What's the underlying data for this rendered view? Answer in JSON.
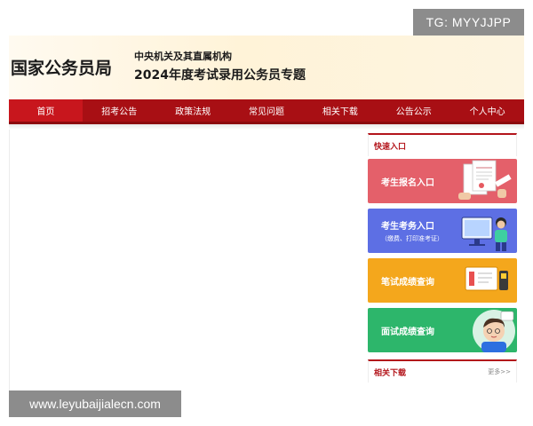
{
  "watermarks": {
    "tg": "TG: MYYJJPP",
    "url": "www.leyubaijialecn.com"
  },
  "banner": {
    "title": "国家公务员局",
    "subtitle_line1": "中央机关及其直属机构",
    "subtitle_line2": "2024年度考试录用公务员专题"
  },
  "nav": {
    "items": [
      {
        "label": "首页"
      },
      {
        "label": "招考公告"
      },
      {
        "label": "政策法规"
      },
      {
        "label": "常见问题"
      },
      {
        "label": "相关下载"
      },
      {
        "label": "公告公示"
      },
      {
        "label": "个人中心"
      }
    ]
  },
  "sidebar": {
    "quick_title": "快速入口",
    "cards": [
      {
        "label": "考生报名入口",
        "sub": ""
      },
      {
        "label": "考生考务入口",
        "sub": "（缴费、打印准考证）"
      },
      {
        "label": "笔试成绩查询",
        "sub": ""
      },
      {
        "label": "面试成绩查询",
        "sub": ""
      }
    ],
    "related_title": "相关下载",
    "more_label": "更多>>"
  },
  "colors": {
    "brand_red": "#a80f14",
    "card_pink": "#e4606a",
    "card_blue": "#5d6fe4",
    "card_orange": "#f4a71c",
    "card_green": "#2db66b"
  }
}
